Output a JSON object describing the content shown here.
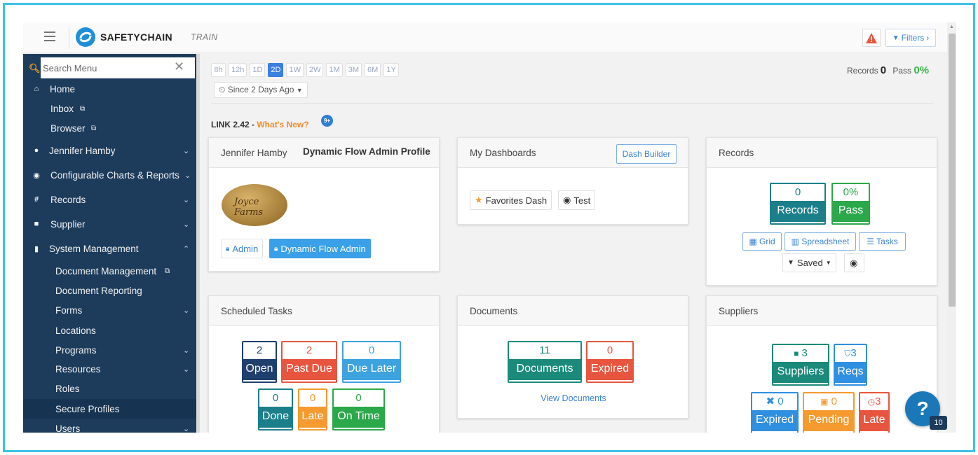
{
  "header": {
    "brand": "SAFETYCHAIN",
    "env": "TRAIN",
    "filters_label": "Filters",
    "filters_chevron": "›"
  },
  "sidebar": {
    "search_placeholder": "Search Menu",
    "items": [
      {
        "label": "Home",
        "icon": "home-icon"
      },
      {
        "label": "Inbox",
        "icon": "external-link-icon"
      },
      {
        "label": "Browser",
        "icon": "external-link-icon"
      },
      {
        "label": "Jennifer Hamby",
        "icon": "user-icon"
      },
      {
        "label": "Configurable Charts & Reports",
        "icon": "dashboard-icon"
      },
      {
        "label": "Records",
        "icon": "hash-icon"
      },
      {
        "label": "Supplier",
        "icon": "truck-icon"
      },
      {
        "label": "System Management",
        "icon": "document-icon"
      },
      {
        "label": "Document Management",
        "icon": "external-link-icon"
      },
      {
        "label": "Document Reporting"
      },
      {
        "label": "Forms"
      },
      {
        "label": "Locations"
      },
      {
        "label": "Programs"
      },
      {
        "label": "Resources"
      },
      {
        "label": "Roles"
      },
      {
        "label": "Secure Profiles"
      },
      {
        "label": "Users"
      }
    ]
  },
  "time_ranges": [
    "8h",
    "12h",
    "1D",
    "2D",
    "1W",
    "2W",
    "1M",
    "3M",
    "6M",
    "1Y"
  ],
  "selected_range": "2D",
  "since_label": "Since 2 Days Ago",
  "summary": {
    "records_label": "Records",
    "records": "0",
    "pass_label": "Pass",
    "pass": "0%"
  },
  "link": {
    "version": "LINK 2.42 - ",
    "whats_new": "What's New?",
    "badge": "9+"
  },
  "profile_card": {
    "user": "Jennifer Hamby",
    "profile": "Dynamic Flow Admin Profile",
    "avatar_text": "Joyce Farms",
    "role1": "Admin",
    "role2": "Dynamic Flow Admin"
  },
  "dashboards_card": {
    "title": "My Dashboards",
    "builder": "Dash Builder",
    "dash1": "Favorites Dash",
    "dash2": "Test"
  },
  "records_card": {
    "title": "Records",
    "records_num": "0",
    "records_label": "Records",
    "pass_num": "0%",
    "pass_label": "Pass",
    "grid": "Grid",
    "spreadsheet": "Spreadsheet",
    "tasks": "Tasks",
    "saved": "Saved"
  },
  "tasks_card": {
    "title": "Scheduled Tasks",
    "open_num": "2",
    "open": "Open",
    "pastdue_num": "2",
    "pastdue": "Past Due",
    "duelater_num": "0",
    "duelater": "Due Later",
    "done_num": "0",
    "done": "Done",
    "late_num": "0",
    "late": "Late",
    "ontime_num": "0",
    "ontime": "On Time"
  },
  "documents_card": {
    "title": "Documents",
    "docs_num": "11",
    "docs": "Documents",
    "expired_num": "0",
    "expired": "Expired",
    "view": "View Documents"
  },
  "suppliers_card": {
    "title": "Suppliers",
    "suppliers_num": "3",
    "suppliers": "Suppliers",
    "reqs_num": "3",
    "reqs": "Reqs",
    "expired_num": "0",
    "expired": "Expired",
    "pending_num": "0",
    "pending": "Pending",
    "late_num": "3",
    "late": "Late"
  },
  "help": {
    "label": "?",
    "count": "10"
  },
  "colors": {
    "accent": "#3b7fe0",
    "sidebar": "#1d3c5c",
    "frame": "#3cc0e6"
  }
}
